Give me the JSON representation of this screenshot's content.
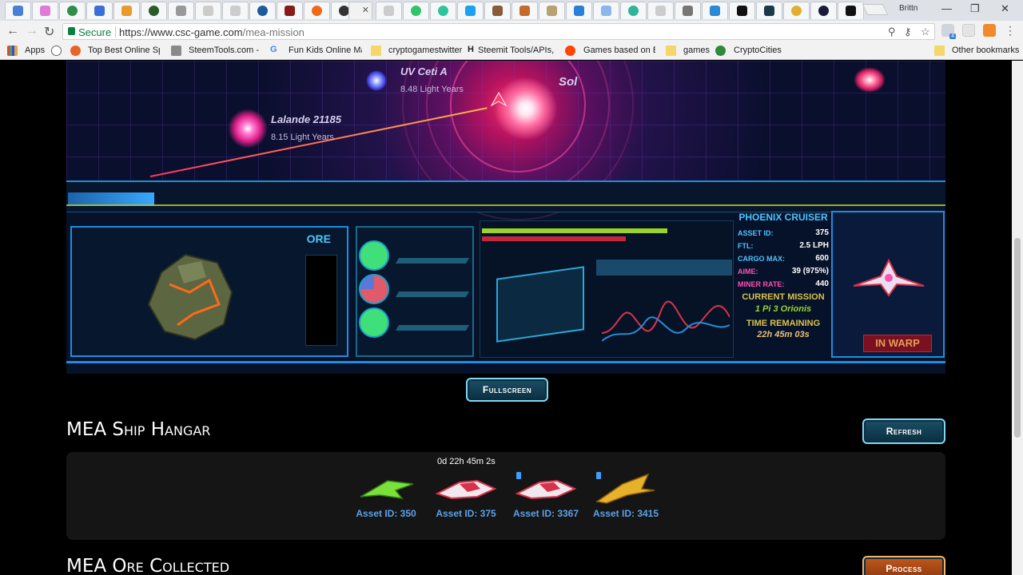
{
  "browser": {
    "user_name": "Brittn",
    "secure_label": "Secure",
    "url_host": "https://www.csc-game.com",
    "url_path": "/mea-mission",
    "bookmarks": [
      {
        "label": "Apps"
      },
      {
        "label": "Top Best Online Spo"
      },
      {
        "label": "SteemTools.com - Ar"
      },
      {
        "label": "Fun Kids Online Mat"
      },
      {
        "label": "cryptogamestwitter"
      },
      {
        "label": "Steemit Tools/APIs, S"
      },
      {
        "label": "Games based on Blo"
      },
      {
        "label": "games"
      },
      {
        "label": "CryptoCities"
      },
      {
        "label": "Other bookmarks"
      }
    ],
    "extension_badge": "4"
  },
  "game": {
    "stars": [
      {
        "name": "UV Ceti A",
        "distance": "8.48 Light Years"
      },
      {
        "name": "Lalande 21185",
        "distance": "8.15 Light Years"
      },
      {
        "name": "Sol",
        "distance": ""
      }
    ],
    "ore_title": "ORE",
    "ship_title": "PHOENIX CRUISER",
    "stats": [
      {
        "label": "ASSET ID:",
        "value": "375",
        "color": "cyan"
      },
      {
        "label": "FTL:",
        "value": "2.5 LPH",
        "color": "cyan"
      },
      {
        "label": "CARGO MAX:",
        "value": "600",
        "color": "cyan"
      },
      {
        "label": "AIME:",
        "value": "39 (975%)",
        "color": "pink"
      },
      {
        "label": "MINER RATE:",
        "value": "440",
        "color": "pink"
      }
    ],
    "current_mission_label": "CURRENT MISSION",
    "current_mission": "1 Pi 3 Orionis",
    "time_remaining_label": "TIME REMAINING",
    "time_remaining": "22h 45m 03s",
    "warp_status": "IN WARP"
  },
  "controls": {
    "fullscreen": "Fullscreen",
    "refresh": "Refresh",
    "process": "Process"
  },
  "hangar": {
    "title": "MEA Ship Hangar",
    "timer": "0d 22h 45m 2s",
    "ships": [
      {
        "asset": "Asset ID: 350",
        "color": "#7be03a"
      },
      {
        "asset": "Asset ID: 375",
        "color": "#d8324a"
      },
      {
        "asset": "Asset ID: 3367",
        "color": "#d8324a"
      },
      {
        "asset": "Asset ID: 3415",
        "color": "#e6b22a"
      }
    ]
  },
  "ore_section": {
    "title": "MEA Ore Collected"
  }
}
